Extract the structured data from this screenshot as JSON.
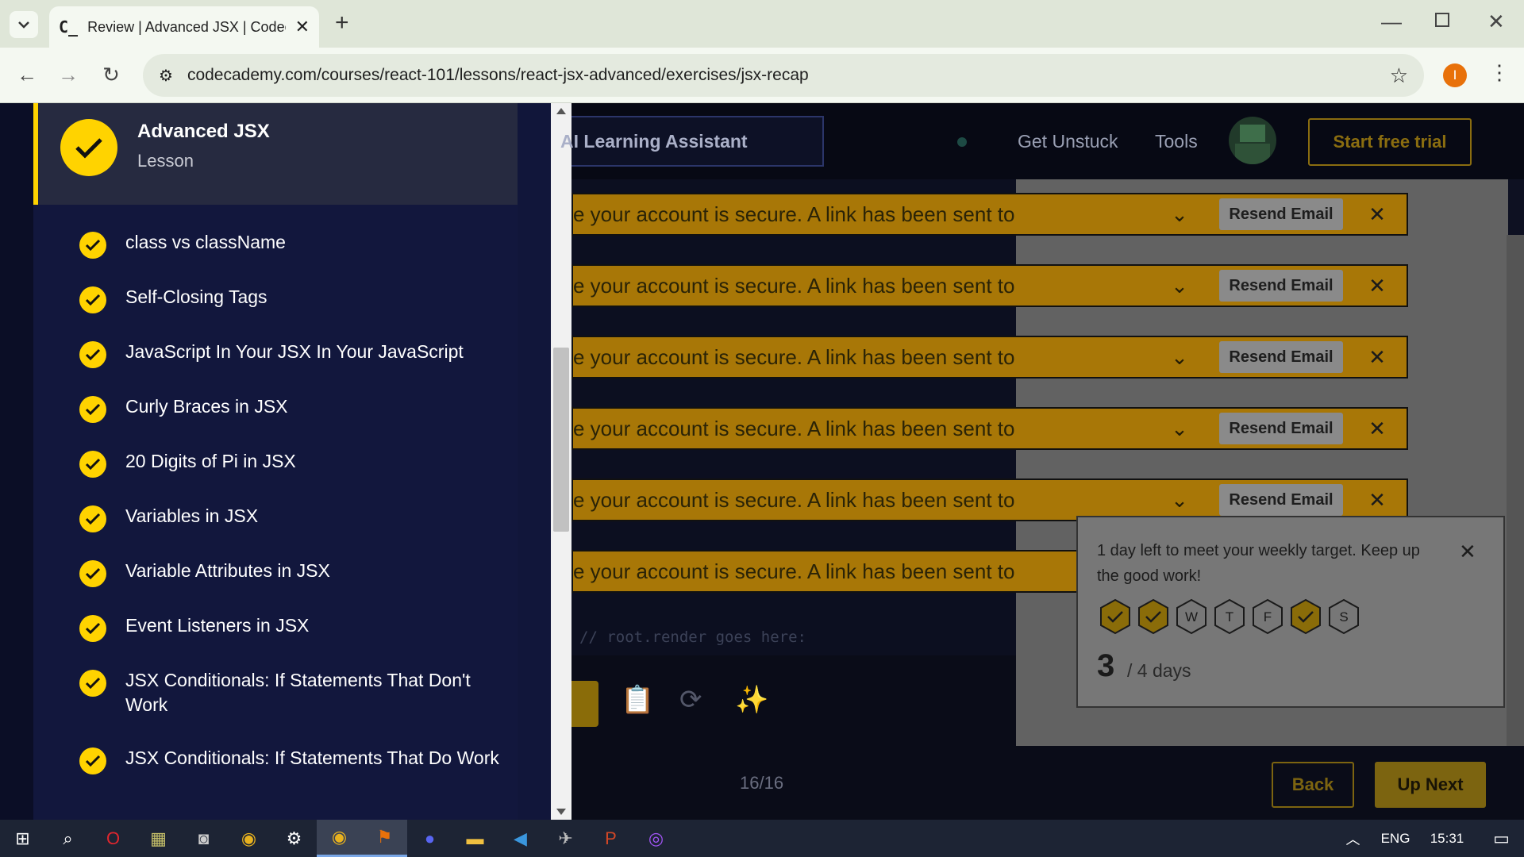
{
  "browser": {
    "tab_title": "Review | Advanced JSX | Codeca",
    "url": "codecademy.com/courses/react-101/lessons/react-jsx-advanced/exercises/jsx-recap",
    "profile_initial": "I"
  },
  "sidebar": {
    "lesson_title": "Advanced JSX",
    "lesson_type": "Lesson",
    "exercises": [
      {
        "label": "class vs className"
      },
      {
        "label": "Self-Closing Tags"
      },
      {
        "label": "JavaScript In Your JSX In Your JavaScript"
      },
      {
        "label": "Curly Braces in JSX"
      },
      {
        "label": "20 Digits of Pi in JSX"
      },
      {
        "label": "Variables in JSX"
      },
      {
        "label": "Variable Attributes in JSX"
      },
      {
        "label": "Event Listeners in JSX"
      },
      {
        "label": "JSX Conditionals: If Statements That Don't Work"
      },
      {
        "label": "JSX Conditionals: If Statements That Do Work"
      }
    ]
  },
  "header": {
    "ai_assistant": "AI Learning Assistant",
    "get_unstuck": "Get Unstuck",
    "tools": "Tools",
    "start_trial": "Start free trial"
  },
  "banners": [
    {
      "message": "e your account is secure. A link has been sent to",
      "button": "Resend Email"
    },
    {
      "message": "e your account is secure. A link has been sent to",
      "button": "Resend Email"
    },
    {
      "message": "e your account is secure. A link has been sent to",
      "button": "Resend Email"
    },
    {
      "message": "e your account is secure. A link has been sent to",
      "button": "Resend Email"
    },
    {
      "message": "e your account is secure. A link has been sent to",
      "button": "Resend Email"
    },
    {
      "message": "e your account is secure. A link has been sent to",
      "button": ""
    }
  ],
  "weekly_target": {
    "message": "1 day left to meet your weekly target. Keep up the good work!",
    "days": [
      {
        "letter": "",
        "done": true
      },
      {
        "letter": "",
        "done": true
      },
      {
        "letter": "W",
        "done": false
      },
      {
        "letter": "T",
        "done": false
      },
      {
        "letter": "F",
        "done": false
      },
      {
        "letter": "",
        "done": true
      },
      {
        "letter": "S",
        "done": false
      }
    ],
    "count": "3",
    "goal_text": "/ 4 days"
  },
  "editor": {
    "code_comment": "// root.render goes here:"
  },
  "footer": {
    "progress": "16/16",
    "back": "Back",
    "up_next": "Up Next"
  },
  "taskbar": {
    "language": "ENG",
    "time": "15:31"
  },
  "colors": {
    "accent_yellow": "#ffd300",
    "sidebar_bg": "#12173d",
    "banner_bg": "#a87707"
  }
}
